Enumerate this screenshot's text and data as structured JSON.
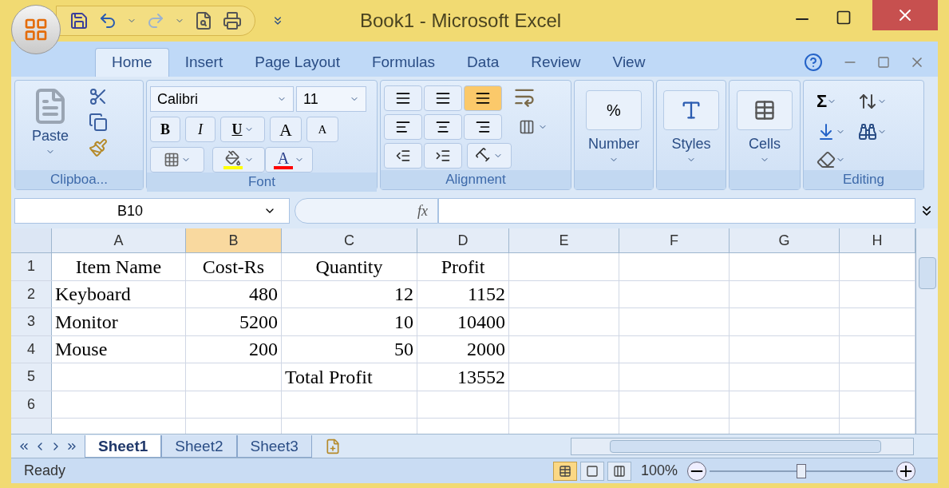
{
  "window": {
    "title": "Book1 - Microsoft Excel"
  },
  "tabs": [
    {
      "label": "Home",
      "selected": true
    },
    {
      "label": "Insert",
      "selected": false
    },
    {
      "label": "Page Layout",
      "selected": false
    },
    {
      "label": "Formulas",
      "selected": false
    },
    {
      "label": "Data",
      "selected": false
    },
    {
      "label": "Review",
      "selected": false
    },
    {
      "label": "View",
      "selected": false
    }
  ],
  "ribbon": {
    "clipboard": {
      "label": "Clipboa...",
      "paste": "Paste"
    },
    "font": {
      "label": "Font",
      "font_name": "Calibri",
      "font_size": "11",
      "bold": "B",
      "italic": "I",
      "underline": "U",
      "grow": "A",
      "shrink": "A",
      "font_color_letter": "A"
    },
    "alignment": {
      "label": "Alignment"
    },
    "number": {
      "label": "Number",
      "symbol": "%"
    },
    "styles": {
      "label": "Styles"
    },
    "cells": {
      "label": "Cells"
    },
    "editing": {
      "label": "Editing",
      "sum": "Σ"
    }
  },
  "formula_bar": {
    "name_box": "B10",
    "fx": "fx"
  },
  "sheet": {
    "columns": [
      {
        "label": "A",
        "selected": false
      },
      {
        "label": "B",
        "selected": true
      },
      {
        "label": "C",
        "selected": false
      },
      {
        "label": "D",
        "selected": false
      },
      {
        "label": "E",
        "selected": false
      },
      {
        "label": "F",
        "selected": false
      },
      {
        "label": "G",
        "selected": false
      },
      {
        "label": "H",
        "selected": false
      }
    ],
    "rows": [
      {
        "label": "1",
        "cells": [
          {
            "value": "Item Name",
            "kind": "header"
          },
          {
            "value": "Cost-Rs",
            "kind": "header"
          },
          {
            "value": "Quantity",
            "kind": "header"
          },
          {
            "value": "Profit",
            "kind": "header"
          }
        ]
      },
      {
        "label": "2",
        "cells": [
          {
            "value": "Keyboard",
            "kind": "text"
          },
          {
            "value": "480",
            "kind": "number"
          },
          {
            "value": "12",
            "kind": "number"
          },
          {
            "value": "1152",
            "kind": "number"
          }
        ]
      },
      {
        "label": "3",
        "cells": [
          {
            "value": "Monitor",
            "kind": "text"
          },
          {
            "value": "5200",
            "kind": "number"
          },
          {
            "value": "10",
            "kind": "number"
          },
          {
            "value": "10400",
            "kind": "number"
          }
        ]
      },
      {
        "label": "4",
        "cells": [
          {
            "value": "Mouse",
            "kind": "text"
          },
          {
            "value": "200",
            "kind": "number"
          },
          {
            "value": "50",
            "kind": "number"
          },
          {
            "value": "2000",
            "kind": "number"
          }
        ]
      },
      {
        "label": "5",
        "cells": [
          null,
          null,
          {
            "value": "Total Profit",
            "kind": "text"
          },
          {
            "value": "13552",
            "kind": "number"
          }
        ]
      },
      {
        "label": "6",
        "cells": []
      }
    ]
  },
  "sheet_tabs": [
    {
      "label": "Sheet1",
      "selected": true
    },
    {
      "label": "Sheet2",
      "selected": false
    },
    {
      "label": "Sheet3",
      "selected": false
    }
  ],
  "status_bar": {
    "status": "Ready",
    "views": [
      {
        "kind": "normal",
        "selected": true
      },
      {
        "kind": "page-layout",
        "selected": false
      },
      {
        "kind": "page-break",
        "selected": false
      }
    ],
    "zoom": "100%",
    "zoom_slider": {
      "level": 0.5
    }
  }
}
